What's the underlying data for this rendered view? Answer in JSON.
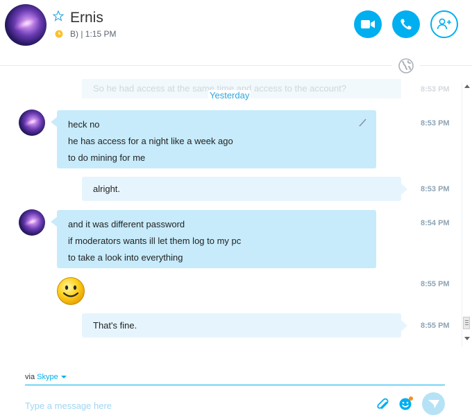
{
  "header": {
    "contact_name": "Ernis",
    "status_text": "B) | 1:15 PM",
    "buttons": {
      "video": "video-call",
      "call": "audio-call",
      "add": "add-people"
    }
  },
  "conversation": {
    "faded_message": "So he had access at the same time and access to the account?",
    "faded_time": "8:53 PM",
    "day_separator": "Yesterday",
    "messages": [
      {
        "lines": [
          "heck no",
          "he has access for a night like a week ago",
          "to do mining for me"
        ],
        "time": "8:53 PM"
      },
      {
        "lines": [
          "alright."
        ],
        "time": "8:53 PM"
      },
      {
        "lines": [
          "and it was different password",
          "if moderators wants ill let them log to my pc",
          "to take a look into everything"
        ],
        "time": "8:54 PM"
      },
      {
        "emoticon": "smile",
        "time": "8:55 PM"
      },
      {
        "lines": [
          "That's fine."
        ],
        "time": "8:55 PM"
      }
    ]
  },
  "composer": {
    "via_prefix": "via",
    "via_service": "Skype",
    "placeholder": "Type a message here"
  },
  "colors": {
    "accent": "#00aff0",
    "incoming_bubble": "#c7ebfb",
    "outgoing_bubble": "#e6f5fd",
    "timestamp": "#8da3b4"
  }
}
